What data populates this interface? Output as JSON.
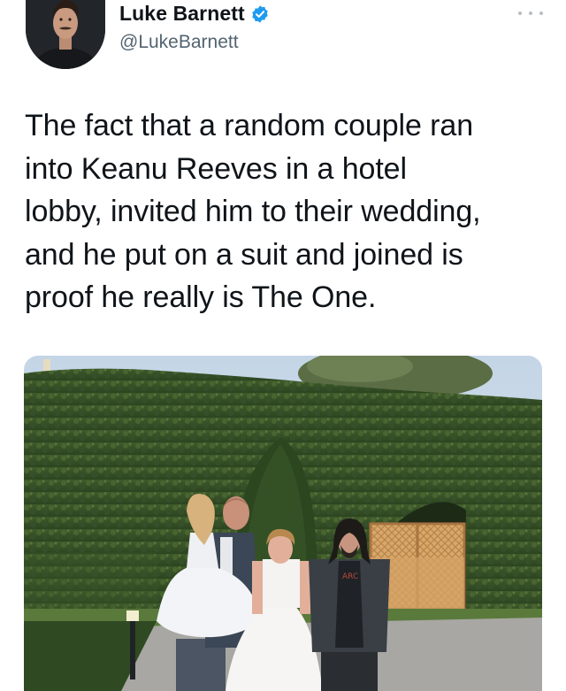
{
  "author": {
    "display_name": "Luke Barnett",
    "handle": "@LukeBarnett",
    "verified": true,
    "avatar_icon": "person-avatar-icon"
  },
  "more_icon": "more-dots-icon",
  "tweet": {
    "text": "The fact that a random couple ran\ninto Keanu Reeves in a hotel\nlobby, invited him to their wedding,\nand he put on a suit and joined is\nproof he really is The One."
  },
  "media": {
    "type": "photo",
    "shirt_print": "ARC"
  },
  "colors": {
    "verified_blue": "#1d9bf0",
    "handle_gray": "#536471",
    "text": "#0f1419"
  }
}
